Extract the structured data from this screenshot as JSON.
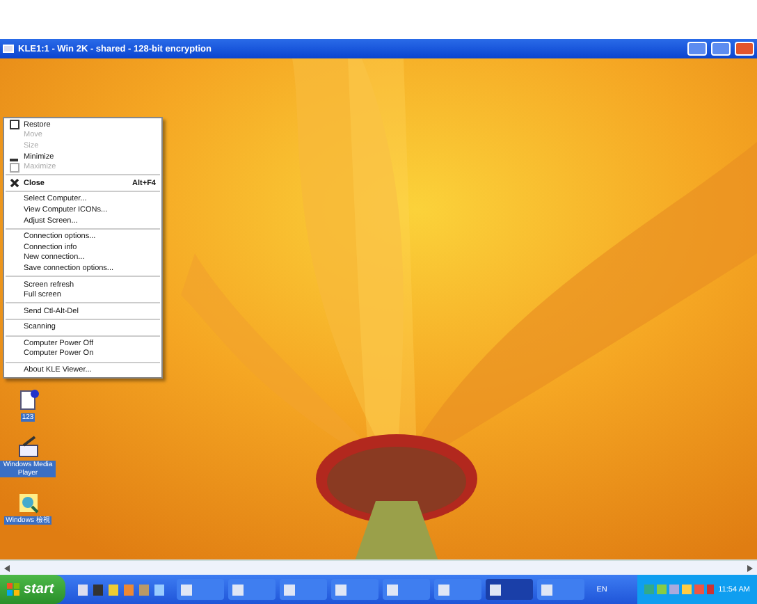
{
  "window": {
    "title": "KLE1:1 - Win 2K - shared - 128-bit encryption"
  },
  "system_menu": [
    {
      "kind": "restore",
      "label": "Restore",
      "disabled": false
    },
    {
      "kind": "plain",
      "label": "Move",
      "disabled": true
    },
    {
      "kind": "plain",
      "label": "Size",
      "disabled": true
    },
    {
      "kind": "minimize",
      "label": "Minimize",
      "disabled": false
    },
    {
      "kind": "maximize",
      "label": "Maximize",
      "disabled": true
    },
    {
      "kind": "separator"
    },
    {
      "kind": "close",
      "label": "Close",
      "shortcut": "Alt+F4",
      "disabled": false
    },
    {
      "kind": "separator"
    },
    {
      "kind": "plain",
      "label": "Select Computer...",
      "disabled": false
    },
    {
      "kind": "plain",
      "label": "View Computer ICONs...",
      "disabled": false
    },
    {
      "kind": "plain",
      "label": "Adjust Screen...",
      "disabled": false
    },
    {
      "kind": "separator"
    },
    {
      "kind": "plain",
      "label": "Connection options...",
      "disabled": false
    },
    {
      "kind": "plain",
      "label": "Connection info",
      "disabled": false
    },
    {
      "kind": "plain",
      "label": "New connection...",
      "disabled": false
    },
    {
      "kind": "plain",
      "label": "Save connection options...",
      "disabled": false
    },
    {
      "kind": "separator"
    },
    {
      "kind": "plain",
      "label": "Screen refresh",
      "disabled": false
    },
    {
      "kind": "plain",
      "label": "Full screen",
      "disabled": false
    },
    {
      "kind": "separator"
    },
    {
      "kind": "plain",
      "label": "Send Ctl-Alt-Del",
      "disabled": false
    },
    {
      "kind": "separator"
    },
    {
      "kind": "plain",
      "label": "Scanning",
      "disabled": false
    },
    {
      "kind": "separator"
    },
    {
      "kind": "plain",
      "label": "Computer Power Off",
      "disabled": false
    },
    {
      "kind": "plain",
      "label": "Computer Power On",
      "disabled": false
    },
    {
      "kind": "separator"
    },
    {
      "kind": "plain",
      "label": "About KLE Viewer...",
      "disabled": false
    }
  ],
  "desktop_icons": [
    {
      "label": "123",
      "kind": "document"
    },
    {
      "label": "Windows Media Player",
      "kind": "media"
    },
    {
      "label": "Windows 檢視",
      "kind": "viewer"
    }
  ],
  "taskbar": {
    "start": "start",
    "task_buttons": [
      {
        "selected": false
      },
      {
        "selected": false
      },
      {
        "selected": false
      },
      {
        "selected": false
      },
      {
        "selected": false
      },
      {
        "selected": false
      },
      {
        "selected": true
      },
      {
        "selected": false
      }
    ],
    "language": "EN",
    "clock": "11:54 AM"
  }
}
